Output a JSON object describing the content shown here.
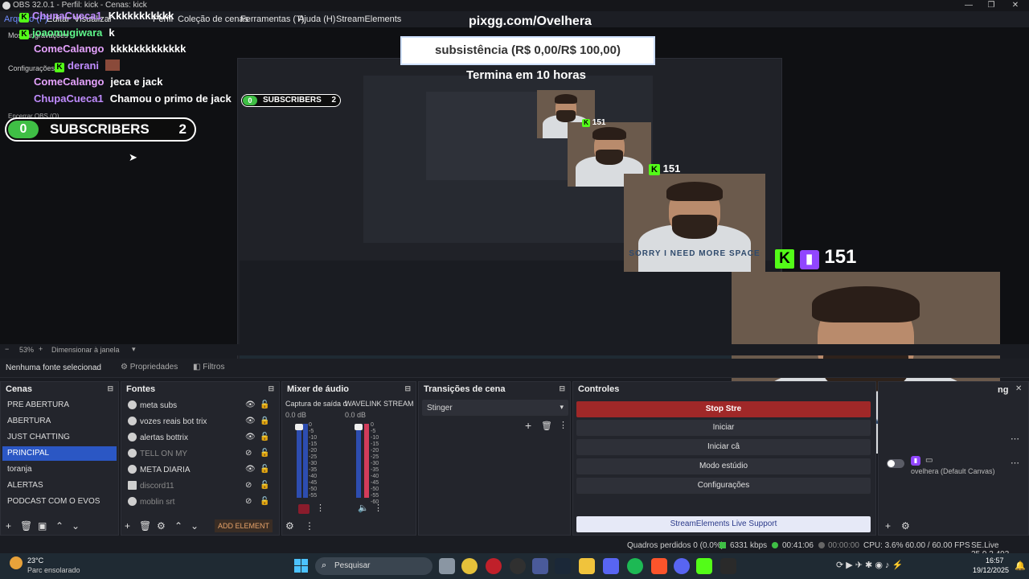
{
  "window": {
    "title": "OBS 32.0.1 - Perfil: kick - Cenas: kick"
  },
  "menu": [
    "Arquivo (F)",
    "Editar",
    "Visualizar",
    "Perfil",
    "Coleção de cenas",
    "Ferramentas (T)",
    "Ajuda (H)",
    "StreamElements"
  ],
  "file_menu_ghost": [
    "Mostrar gravações",
    "Configurações",
    "Encerrar OBS (Q)"
  ],
  "chat": [
    {
      "user": "ChunaCueca1",
      "msg": "Kkkkkkkkkkk",
      "color": "#c08cff"
    },
    {
      "user": "joaomugiwara",
      "msg": "k",
      "color": "#5ef58a"
    },
    {
      "user": "ComeCalango",
      "msg": "kkkkkkkkkkkkk",
      "color": "#e6a3ff"
    },
    {
      "user": "derani",
      "msg": "",
      "color": "#c08cff"
    },
    {
      "user": "ComeCalango",
      "msg": "jeca e jack",
      "color": "#e6a3ff"
    },
    {
      "user": "ChupaCueca1",
      "msg": "Chamou o primo de jack",
      "color": "#c08cff"
    }
  ],
  "overlay": {
    "subs_left": "0",
    "subs_label": "SUBSCRIBERS",
    "subs_right": "2",
    "pixgg": "pixgg.com/Ovelhera",
    "sub_goal": "subsistência (R$ 0,00/R$ 100,00)",
    "timer": "Termina em 10 horas",
    "viewers": "151",
    "kick_letter": "K",
    "shirt_text": "SORRY I NEED MORE SPACE"
  },
  "zoom": {
    "value": "53%",
    "fit": "Dimensionar à janela"
  },
  "props_bar": {
    "none": "Nenhuma fonte selecionad",
    "properties": "Propriedades",
    "filters": "Filtros"
  },
  "scenes": {
    "title": "Cenas",
    "items": [
      "PRE ABERTURA",
      "ABERTURA",
      "JUST CHATTING",
      "PRINCIPAL",
      "toranja",
      "ALERTAS",
      "PODCAST COM O EVOS"
    ],
    "selected_index": 3
  },
  "sources": {
    "title": "Fontes",
    "items": [
      {
        "name": "meta subs",
        "visible": true,
        "locked": false
      },
      {
        "name": "vozes reais bot trix",
        "visible": true,
        "locked": true
      },
      {
        "name": "alertas bottrix",
        "visible": true,
        "locked": false
      },
      {
        "name": "TELL ON MY",
        "visible": false,
        "locked": false
      },
      {
        "name": "META DIARIA",
        "visible": true,
        "locked": false
      },
      {
        "name": "discord11",
        "visible": false,
        "locked": false
      },
      {
        "name": "moblin srt",
        "visible": false,
        "locked": false
      }
    ],
    "add_element": "ADD ELEMENT"
  },
  "mixer": {
    "title": "Mixer de áudio",
    "channels": [
      {
        "name": "Captura de saída d",
        "db": "0.0 dB"
      },
      {
        "name": "WAVELINK STREAM",
        "db": "0.0 dB"
      }
    ],
    "scale": [
      "0",
      "-5",
      "-10",
      "-15",
      "-20",
      "-25",
      "-30",
      "-35",
      "-40",
      "-45",
      "-50",
      "-55",
      "-60"
    ]
  },
  "transitions": {
    "title": "Transições de cena",
    "selected": "Stinger"
  },
  "controls": {
    "title": "Controles",
    "buttons": [
      "Stop Stre",
      "Iniciar",
      "Iniciar câ",
      "Modo estúdio",
      "Configurações"
    ],
    "support": "StreamElements Live Support"
  },
  "right_dock": {
    "canvas_label": "ovelhera (Default Canvas)",
    "tab_suffix": "ng"
  },
  "status": {
    "frames_lost": "Quadros perdidos 0 (0.0%)",
    "bitrate": "6331 kbps",
    "live_time": "00:41:06",
    "rec_time": "00:00:00",
    "cpu": "CPU: 3.6%",
    "fps": "60.00 / 60.00 FPS",
    "version": "SE.Live 25.9.3.493"
  },
  "taskbar": {
    "temp": "23°C",
    "weather": "Parc ensolarado",
    "search": "Pesquisar",
    "time": "16:57",
    "date": "19/12/2025"
  },
  "colors": {
    "kick_green": "#53fc18",
    "twitch_purple": "#9146ff",
    "selected_scene": "#2b57c4",
    "stop_button": "#a02828"
  }
}
